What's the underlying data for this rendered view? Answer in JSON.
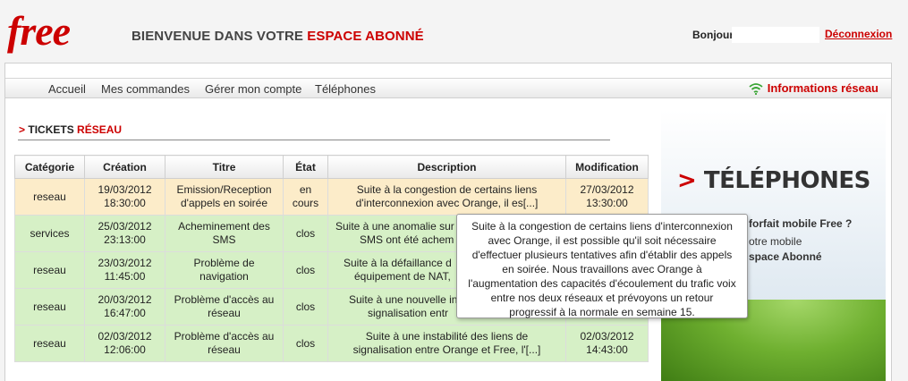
{
  "header": {
    "logo": "free",
    "welcome_prefix": "BIENVENUE DANS VOTRE ",
    "welcome_highlight": "ESPACE ABONNÉ",
    "greeting": "Bonjour",
    "logout": "Déconnexion"
  },
  "nav": {
    "items": [
      "Accueil",
      "Mes commandes",
      "Gérer mon compte",
      "Téléphones"
    ],
    "network_info": "Informations réseau"
  },
  "section": {
    "arrow": ">",
    "title_prefix": "TICKETS ",
    "title_highlight": "RÉSEAU"
  },
  "table": {
    "headers": [
      "Catégorie",
      "Création",
      "Titre",
      "État",
      "Description",
      "Modification"
    ],
    "rows": [
      {
        "categorie": "reseau",
        "creation_date": "19/03/2012",
        "creation_time": "18:30:00",
        "titre_1": "Emission/Reception",
        "titre_2": "d'appels en soirée",
        "etat_1": "en",
        "etat_2": "cours",
        "desc_1": "Suite à la congestion de certains liens",
        "desc_2": "d'interconnexion avec Orange, il es[...]",
        "modif_date": "27/03/2012",
        "modif_time": "13:30:00"
      },
      {
        "categorie": "services",
        "creation_date": "25/03/2012",
        "creation_time": "23:13:00",
        "titre_1": "Acheminement des",
        "titre_2": "SMS",
        "etat_1": "clos",
        "etat_2": "",
        "desc_1": "Suite à une anomalie sur",
        "desc_2": "SMS ont été achem",
        "modif_date": "",
        "modif_time": ""
      },
      {
        "categorie": "reseau",
        "creation_date": "23/03/2012",
        "creation_time": "11:45:00",
        "titre_1": "Problème de",
        "titre_2": "navigation",
        "etat_1": "clos",
        "etat_2": "",
        "desc_1": "Suite à la défaillance d",
        "desc_2": "équipement de NAT,",
        "modif_date": "",
        "modif_time": ""
      },
      {
        "categorie": "reseau",
        "creation_date": "20/03/2012",
        "creation_time": "16:47:00",
        "titre_1": "Problème d'accès au",
        "titre_2": "réseau",
        "etat_1": "clos",
        "etat_2": "",
        "desc_1": "Suite à une nouvelle ins",
        "desc_2": "signalisation entr",
        "modif_date": "",
        "modif_time": ""
      },
      {
        "categorie": "reseau",
        "creation_date": "02/03/2012",
        "creation_time": "12:06:00",
        "titre_1": "Problème d'accès au",
        "titre_2": "réseau",
        "etat_1": "clos",
        "etat_2": "",
        "desc_1": "Suite à une instabilité des liens de",
        "desc_2": "signalisation entre Orange et Free, l'[...]",
        "modif_date": "02/03/2012",
        "modif_time": "14:43:00"
      }
    ]
  },
  "tooltip": {
    "text": "Suite à la congestion de certains liens d'interconnexion avec Orange, il est possible qu'il soit nécessaire d'effectuer plusieurs tentatives afin d'établir des appels en soirée. Nous travaillons avec Orange à l'augmentation des capacités d'écoulement du trafic voix entre nos deux réseaux et prévoyons un retour progressif à la normale en semaine 15."
  },
  "banner": {
    "arrow": ">",
    "title": "TÉLÉPHONES",
    "line1": "forfait mobile Free ?",
    "line2": "otre mobile",
    "line3": "space Abonné"
  },
  "colors": {
    "brand_red": "#cc0000",
    "open_row": "#fcecc9",
    "closed_row": "#d6f0c6",
    "wifi_green": "#3aa535"
  }
}
